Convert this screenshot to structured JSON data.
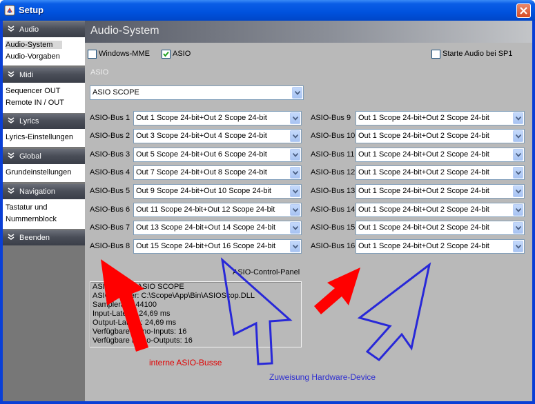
{
  "window": {
    "title": "Setup"
  },
  "sidebar": {
    "groups": [
      {
        "label": "Audio",
        "items": [
          "Audio-System",
          "Audio-Vorgaben"
        ],
        "selected": 0
      },
      {
        "label": "Midi",
        "items": [
          "Sequencer OUT",
          "Remote IN / OUT"
        ]
      },
      {
        "label": "Lyrics",
        "items": [
          "Lyrics-Einstellungen"
        ]
      },
      {
        "label": "Global",
        "items": [
          "Grundeinstellungen"
        ]
      },
      {
        "label": "Navigation",
        "items": [
          "Tastatur  und",
          "Nummernblock"
        ]
      },
      {
        "label": "Beenden",
        "items": []
      }
    ]
  },
  "main": {
    "title": "Audio-System",
    "options": {
      "windows_mme": {
        "label": "Windows-MME",
        "checked": false
      },
      "asio": {
        "label": "ASIO",
        "checked": true
      },
      "start_audio": {
        "label": "Starte Audio bei SP1",
        "checked": false
      }
    },
    "asio_section_label": "ASIO",
    "asio_driver": "ASIO SCOPE",
    "buses_left": [
      {
        "label": "ASIO-Bus 1",
        "value": "Out 1 Scope 24-bit+Out 2 Scope 24-bit"
      },
      {
        "label": "ASIO-Bus 2",
        "value": "Out 3 Scope 24-bit+Out 4 Scope 24-bit"
      },
      {
        "label": "ASIO-Bus 3",
        "value": "Out 5 Scope 24-bit+Out 6 Scope 24-bit"
      },
      {
        "label": "ASIO-Bus 4",
        "value": "Out 7 Scope 24-bit+Out 8 Scope 24-bit"
      },
      {
        "label": "ASIO-Bus 5",
        "value": "Out 9 Scope 24-bit+Out 10 Scope 24-bit"
      },
      {
        "label": "ASIO-Bus 6",
        "value": "Out 11 Scope 24-bit+Out 12 Scope 24-bit"
      },
      {
        "label": "ASIO-Bus 7",
        "value": "Out 13 Scope 24-bit+Out 14 Scope 24-bit"
      },
      {
        "label": "ASIO-Bus 8",
        "value": "Out 15 Scope 24-bit+Out 16 Scope 24-bit"
      }
    ],
    "buses_right": [
      {
        "label": "ASIO-Bus 9",
        "value": "Out 1 Scope 24-bit+Out 2 Scope 24-bit"
      },
      {
        "label": "ASIO-Bus 10",
        "value": "Out 1 Scope 24-bit+Out 2 Scope 24-bit"
      },
      {
        "label": "ASIO-Bus 11",
        "value": "Out 1 Scope 24-bit+Out 2 Scope 24-bit"
      },
      {
        "label": "ASIO-Bus 12",
        "value": "Out 1 Scope 24-bit+Out 2 Scope 24-bit"
      },
      {
        "label": "ASIO-Bus 13",
        "value": "Out 1 Scope 24-bit+Out 2 Scope 24-bit"
      },
      {
        "label": "ASIO-Bus 14",
        "value": "Out 1 Scope 24-bit+Out 2 Scope 24-bit"
      },
      {
        "label": "ASIO-Bus 15",
        "value": "Out 1 Scope 24-bit+Out 2 Scope 24-bit"
      },
      {
        "label": "ASIO-Bus 16",
        "value": "Out 1 Scope 24-bit+Out 2 Scope 24-bit"
      }
    ],
    "control_panel_title": "ASIO-Control-Panel",
    "info_lines": [
      "ASIO-Name: ASIO SCOPE",
      "ASIO-Treiber: C:\\Scope\\App\\Bin\\ASIOScop.DLL",
      "Samplerate: 44100",
      "Input-Latenz: 24,69 ms",
      "Output-Latenz: 24,69 ms",
      "Verfügbare Mono-Inputs: 16",
      "Verfügbare Mono-Outputs: 16"
    ]
  },
  "annotations": {
    "red_label": "interne ASIO-Busse",
    "blue_label": "Zuweisung Hardware-Device",
    "red_color": "#ff0000",
    "blue_color": "#3030d0"
  }
}
